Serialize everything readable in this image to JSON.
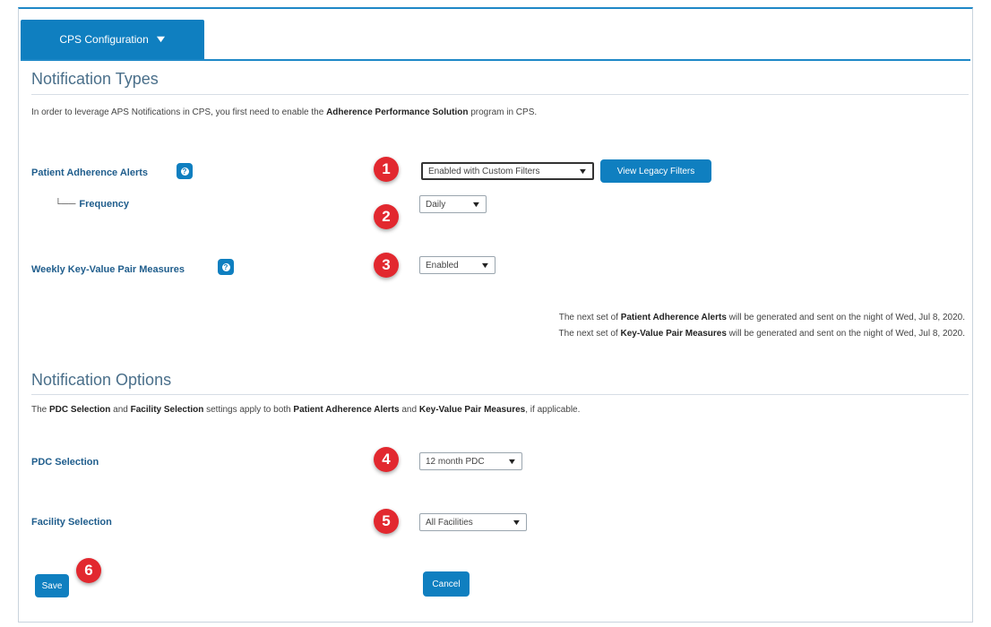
{
  "header": {
    "tab_label": "CPS Configuration"
  },
  "notification_types": {
    "title": "Notification Types",
    "intro_pre": "In order to leverage APS Notifications in CPS, you first need to enable the ",
    "intro_bold": "Adherence Performance Solution",
    "intro_post": " program in CPS.",
    "patient_alerts": {
      "label": "Patient Adherence Alerts",
      "marker": "1",
      "value": "Enabled with Custom Filters",
      "legacy_button": "View Legacy Filters"
    },
    "frequency": {
      "label": "Frequency",
      "branch": "└──",
      "marker": "2",
      "value": "Daily"
    },
    "weekly_kvp": {
      "label": "Weekly Key-Value Pair Measures",
      "marker": "3",
      "value": "Enabled"
    },
    "notes": [
      {
        "pre": "The next set of ",
        "bold": "Patient Adherence Alerts",
        "post": " will be generated and sent on the night of Wed, Jul 8, 2020."
      },
      {
        "pre": "The next set of ",
        "bold": "Key-Value Pair Measures",
        "post": " will be generated and sent on the night of Wed, Jul 8, 2020."
      }
    ]
  },
  "notification_options": {
    "title": "Notification Options",
    "intro": {
      "t1": "The ",
      "b1": "PDC Selection",
      "t2": " and ",
      "b2": "Facility Selection",
      "t3": " settings apply to both ",
      "b3": "Patient Adherence Alerts",
      "t4": " and ",
      "b4": "Key-Value Pair Measures",
      "t5": ", if applicable."
    },
    "pdc": {
      "label": "PDC Selection",
      "marker": "4",
      "value": "12 month PDC"
    },
    "facility": {
      "label": "Facility Selection",
      "marker": "5",
      "value": "All Facilities"
    }
  },
  "actions": {
    "save_label": "Save",
    "save_marker": "6",
    "cancel_label": "Cancel"
  },
  "icons": {
    "help": "question-icon",
    "caret": "chevron-down-icon"
  },
  "colors": {
    "accent": "#0f7fc0",
    "marker": "#e2282f",
    "section_title": "#4a6f8a",
    "label": "#1f5d8c"
  }
}
